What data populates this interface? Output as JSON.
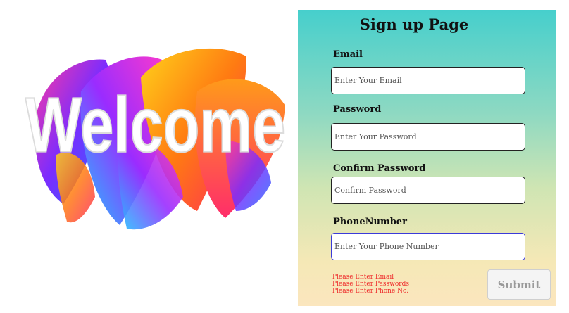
{
  "hero": {
    "word": "Welcome"
  },
  "signup": {
    "title": "Sign up Page",
    "email": {
      "label": "Email",
      "placeholder": "Enter Your Email",
      "value": ""
    },
    "password": {
      "label": "Password",
      "placeholder": "Enter Your Password",
      "value": ""
    },
    "confirm": {
      "label": "Confirm Password",
      "placeholder": "Confirm Password",
      "value": ""
    },
    "phone": {
      "label": "PhoneNumber",
      "placeholder": "Enter Your Phone Number",
      "value": ""
    },
    "errors": [
      "Please Enter Email",
      "Please Enter Passwords",
      "Please Enter Phone No."
    ],
    "submit_label": "Submit"
  },
  "colors": {
    "error": "#ee2a2a",
    "focus_border": "#3b3bd9",
    "gradient_top": "#46cfcc",
    "gradient_bottom": "#fbe6be"
  }
}
